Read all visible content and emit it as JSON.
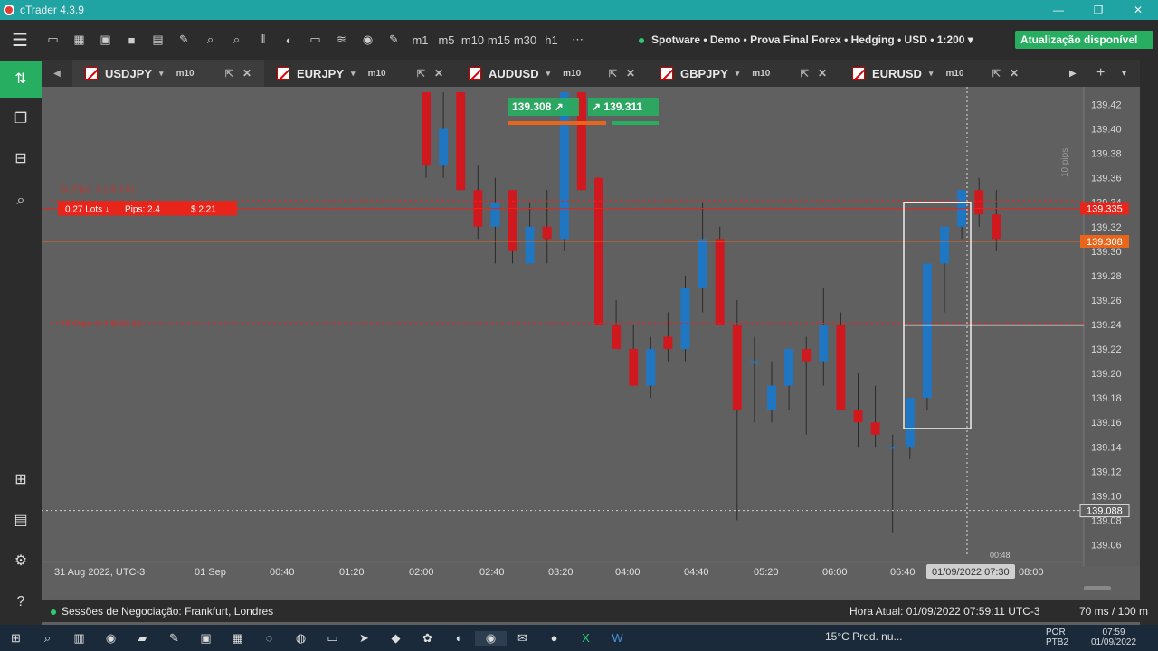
{
  "window": {
    "title": "cTrader 4.3.9"
  },
  "toolbar": {
    "tools": [
      "▭",
      "▦",
      "▣",
      "■",
      "▤",
      "✎",
      "⌕",
      "⌕",
      "⫴",
      "◐",
      "▭",
      "≋",
      "◉",
      "✎",
      "m1",
      "m5",
      "m10",
      "m15",
      "m30",
      "h1",
      "⋯"
    ],
    "account": "Spotware • Demo • Prova Final Forex • Hedging • USD • 1:200",
    "update": "Atualização disponível"
  },
  "tabs": [
    {
      "symbol": "USDJPY",
      "tf": "m10",
      "active": true
    },
    {
      "symbol": "EURJPY",
      "tf": "m10",
      "active": false
    },
    {
      "symbol": "AUDUSD",
      "tf": "m10",
      "active": false
    },
    {
      "symbol": "GBPJPY",
      "tf": "m10",
      "active": false
    },
    {
      "symbol": "EURUSD",
      "tf": "m10",
      "active": false
    }
  ],
  "quote": {
    "bid": "139.30",
    "bid_pip": "8",
    "ask": "139.31",
    "ask_pip": "1"
  },
  "order": {
    "sl": "SL  Pips: 3.1  $ 3.01",
    "lots": "0.27 Lots ↓",
    "pips": "Pips: 2.4",
    "pnl": "$ 2.21",
    "tp": "TP  Pips: 8.7  $ 16.62"
  },
  "status": {
    "sessions": "Sessões de Negociação: Frankfurt, Londres",
    "time": "Hora Atual: 01/09/2022 07:59:11  UTC-3",
    "latency": "70 ms / 100 m"
  },
  "taskbar": {
    "weather": "15°C  Pred. nu...",
    "lang": "POR\nPTB2",
    "clock": "07:59\n01/09/2022"
  },
  "chart_data": {
    "type": "candlestick",
    "symbol": "USDJPY",
    "timeframe": "m10",
    "ylim": [
      139.05,
      139.43
    ],
    "y_ticks": [
      "139.06",
      "139.08",
      "139.10",
      "139.12",
      "139.14",
      "139.16",
      "139.18",
      "139.20",
      "139.22",
      "139.24",
      "139.26",
      "139.28",
      "139.30",
      "139.32",
      "139.34",
      "139.36",
      "139.38",
      "139.40",
      "139.42"
    ],
    "x_ticks": [
      "31 Aug 2022, UTC-3",
      "01 Sep",
      "00:40",
      "01:20",
      "02:00",
      "02:40",
      "03:20",
      "04:00",
      "04:40",
      "05:20",
      "06:00",
      "06:40",
      "01/09/2022 07:30",
      "08:00"
    ],
    "candles": [
      {
        "o": 139.43,
        "h": 139.43,
        "l": 139.36,
        "c": 139.37
      },
      {
        "o": 139.37,
        "h": 139.43,
        "l": 139.36,
        "c": 139.4
      },
      {
        "o": 139.43,
        "h": 139.43,
        "l": 139.35,
        "c": 139.35
      },
      {
        "o": 139.35,
        "h": 139.37,
        "l": 139.31,
        "c": 139.32
      },
      {
        "o": 139.32,
        "h": 139.36,
        "l": 139.29,
        "c": 139.34
      },
      {
        "o": 139.35,
        "h": 139.35,
        "l": 139.29,
        "c": 139.3
      },
      {
        "o": 139.29,
        "h": 139.34,
        "l": 139.29,
        "c": 139.32
      },
      {
        "o": 139.32,
        "h": 139.35,
        "l": 139.29,
        "c": 139.31
      },
      {
        "o": 139.31,
        "h": 139.43,
        "l": 139.3,
        "c": 139.43
      },
      {
        "o": 139.43,
        "h": 139.43,
        "l": 139.35,
        "c": 139.35
      },
      {
        "o": 139.36,
        "h": 139.36,
        "l": 139.24,
        "c": 139.24
      },
      {
        "o": 139.24,
        "h": 139.26,
        "l": 139.22,
        "c": 139.22
      },
      {
        "o": 139.22,
        "h": 139.24,
        "l": 139.19,
        "c": 139.19
      },
      {
        "o": 139.19,
        "h": 139.23,
        "l": 139.18,
        "c": 139.22
      },
      {
        "o": 139.23,
        "h": 139.25,
        "l": 139.21,
        "c": 139.22
      },
      {
        "o": 139.22,
        "h": 139.28,
        "l": 139.21,
        "c": 139.27
      },
      {
        "o": 139.27,
        "h": 139.34,
        "l": 139.25,
        "c": 139.31
      },
      {
        "o": 139.31,
        "h": 139.32,
        "l": 139.24,
        "c": 139.24
      },
      {
        "o": 139.24,
        "h": 139.26,
        "l": 139.08,
        "c": 139.17
      },
      {
        "o": 139.21,
        "h": 139.23,
        "l": 139.16,
        "c": 139.21
      },
      {
        "o": 139.17,
        "h": 139.21,
        "l": 139.16,
        "c": 139.19
      },
      {
        "o": 139.19,
        "h": 139.22,
        "l": 139.17,
        "c": 139.22
      },
      {
        "o": 139.22,
        "h": 139.23,
        "l": 139.15,
        "c": 139.21
      },
      {
        "o": 139.21,
        "h": 139.27,
        "l": 139.19,
        "c": 139.24
      },
      {
        "o": 139.24,
        "h": 139.25,
        "l": 139.17,
        "c": 139.17
      },
      {
        "o": 139.17,
        "h": 139.2,
        "l": 139.14,
        "c": 139.16
      },
      {
        "o": 139.16,
        "h": 139.19,
        "l": 139.14,
        "c": 139.15
      },
      {
        "o": 139.14,
        "h": 139.15,
        "l": 139.07,
        "c": 139.14
      },
      {
        "o": 139.14,
        "h": 139.16,
        "l": 139.13,
        "c": 139.18
      },
      {
        "o": 139.18,
        "h": 139.29,
        "l": 139.17,
        "c": 139.29
      },
      {
        "o": 139.29,
        "h": 139.32,
        "l": 139.25,
        "c": 139.32
      },
      {
        "o": 139.32,
        "h": 139.35,
        "l": 139.31,
        "c": 139.35
      },
      {
        "o": 139.35,
        "h": 139.36,
        "l": 139.32,
        "c": 139.33
      },
      {
        "o": 139.33,
        "h": 139.35,
        "l": 139.3,
        "c": 139.31
      }
    ],
    "price_lines": [
      {
        "label": "139.335",
        "value": 139.335,
        "color": "#e8241b"
      },
      {
        "label": "139.308",
        "value": 139.308,
        "color": "#e8651b"
      },
      {
        "label": "139.088",
        "value": 139.088,
        "color": "#cfcfcf"
      }
    ],
    "pips_label": "10 pips",
    "cursor_time": "00:48"
  }
}
